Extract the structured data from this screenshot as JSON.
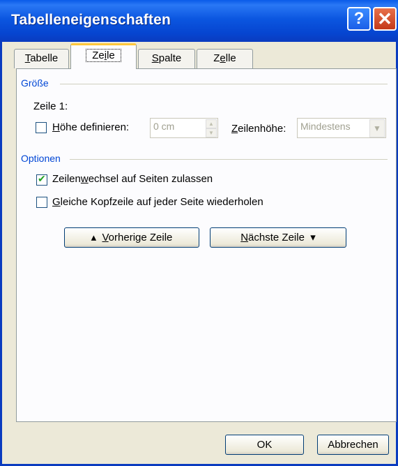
{
  "dialog": {
    "title": "Tabelleneigenschaften"
  },
  "titlebar": {
    "help_label": "?",
    "close_label": "✕"
  },
  "tabs": [
    {
      "label_u": "T",
      "label_rest": "abelle"
    },
    {
      "label_pre": "Ze",
      "label_u": "i",
      "label_rest": "le"
    },
    {
      "label_u": "S",
      "label_rest": "palte"
    },
    {
      "label_pre": "Z",
      "label_u": "e",
      "label_rest": "lle"
    }
  ],
  "groesse": {
    "heading": "Größe",
    "row_label": "Zeile 1:",
    "hoehe_u": "H",
    "hoehe_rest": "öhe definieren:",
    "hoehe_checked": false,
    "height_value": "0 cm",
    "zeilenhoehe_u": "Z",
    "zeilenhoehe_rest": "eilenhöhe:",
    "zeilenhoehe_value": "Mindestens"
  },
  "optionen": {
    "heading": "Optionen",
    "wechsel_pre": "Zeilen",
    "wechsel_u": "w",
    "wechsel_rest": "echsel auf Seiten zulassen",
    "wechsel_checked": true,
    "kopf_u": "G",
    "kopf_rest": "leiche Kopfzeile auf jeder Seite wiederholen",
    "kopf_checked": false
  },
  "nav": {
    "prev_arrow": "▴",
    "prev_u": "V",
    "prev_rest": "orherige Zeile",
    "next_u": "N",
    "next_rest": "ächste Zeile",
    "next_arrow": "▾"
  },
  "footer": {
    "ok_label": "OK",
    "cancel_label": "Abbrechen"
  },
  "colors": {
    "title_bar": "#0a5be8",
    "group_heading": "#0046d5",
    "active_tab_accent": "#ffc83c"
  }
}
